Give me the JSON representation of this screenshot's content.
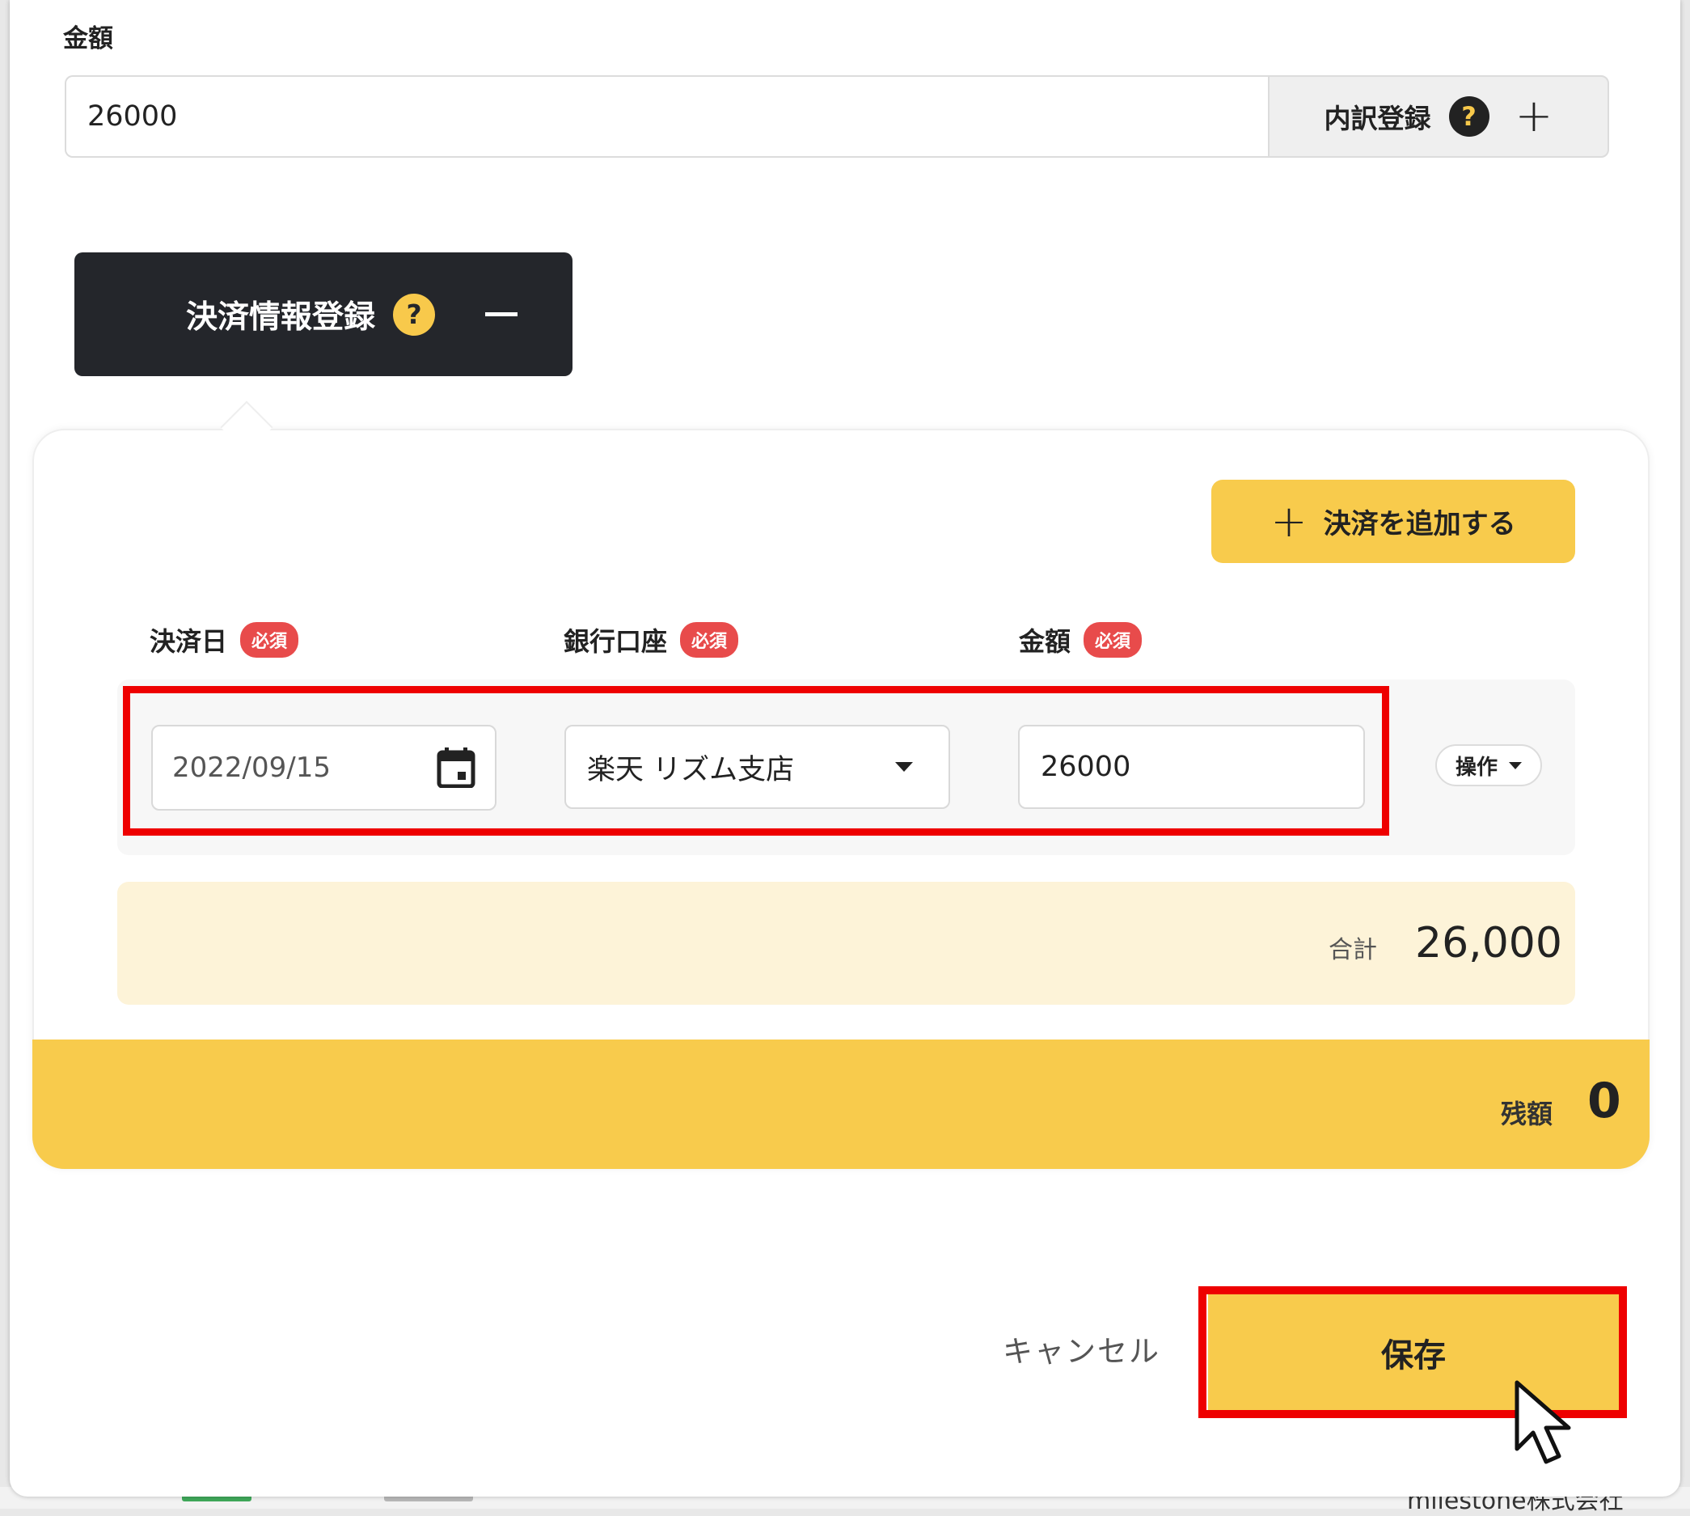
{
  "background": {
    "company_text": "milestone株式会社"
  },
  "amount_section": {
    "label": "金額",
    "value": "26000",
    "breakdown_button_label": "内訳登録",
    "help_glyph": "?",
    "plus_glyph": "+"
  },
  "payment_toggle": {
    "label": "決済情報登録",
    "help_glyph": "?"
  },
  "panel": {
    "add_payment_plus": "+",
    "add_payment_label": "決済を追加する",
    "columns": [
      {
        "label": "決済日",
        "required": "必須"
      },
      {
        "label": "銀行口座",
        "required": "必須"
      },
      {
        "label": "金額",
        "required": "必須"
      }
    ],
    "row": {
      "date": "2022/09/15",
      "bank": "楽天 リズム支店",
      "amount": "26000",
      "ops_label": "操作"
    },
    "total_label": "合計",
    "total_value": "26,000",
    "balance_label": "残額",
    "balance_value": "0"
  },
  "footer": {
    "cancel_label": "キャンセル",
    "save_label": "保存"
  },
  "colors": {
    "accent_yellow": "#f8cb4c",
    "dark": "#24262b",
    "required_red": "#e84b4b",
    "highlight_red": "#ee0000",
    "total_bg": "#fdf3d8"
  },
  "icons": [
    "help-icon",
    "plus-icon",
    "minus-icon",
    "calendar-icon",
    "chevron-down-icon",
    "mouse-cursor-icon"
  ]
}
